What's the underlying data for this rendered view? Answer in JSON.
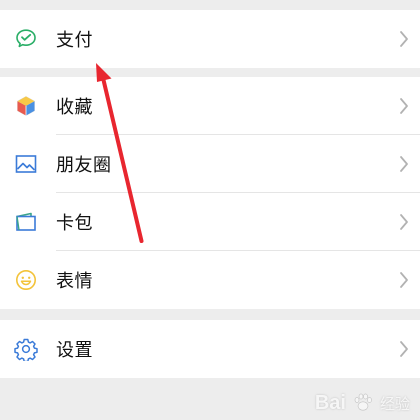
{
  "menu": {
    "pay": {
      "label": "支付",
      "icon": "wechat-pay-icon"
    },
    "favorites": {
      "label": "收藏",
      "icon": "favorites-cube-icon"
    },
    "moments": {
      "label": "朋友圈",
      "icon": "moments-picture-icon"
    },
    "cards": {
      "label": "卡包",
      "icon": "card-wallet-icon"
    },
    "stickers": {
      "label": "表情",
      "icon": "smiley-icon"
    },
    "settings": {
      "label": "设置",
      "icon": "gear-icon"
    }
  },
  "watermark": {
    "text_en": "Bai",
    "text_cn": "经验"
  },
  "colors": {
    "background": "#ededed",
    "row": "#ffffff",
    "arrow": "#e8262f",
    "pay_green": "#2aae67",
    "settings_blue": "#3b7bd8",
    "stickers_yellow": "#f3c33a"
  }
}
